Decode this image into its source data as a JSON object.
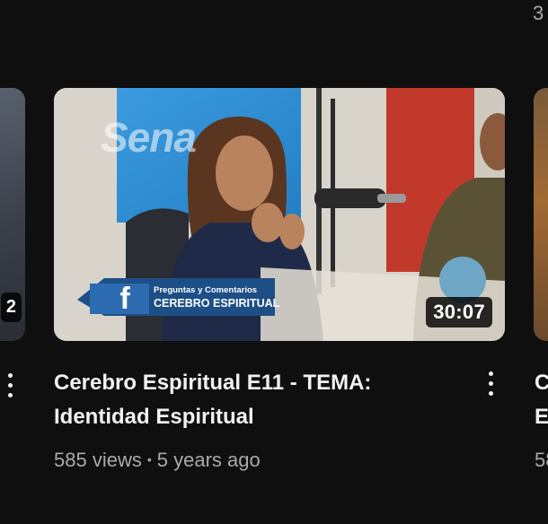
{
  "corner_count": "3",
  "left_card": {
    "duration": "2"
  },
  "main_card": {
    "duration": "30:07",
    "title": "Cerebro Espiritual E11 - TEMA: Identidad Espiritual",
    "views": "585 views",
    "separator": "•",
    "age": "5 years ago",
    "overlay": {
      "subtitle": "Preguntas y Comentarios",
      "show_name": "CEREBRO ESPIRITUAL",
      "logo": "Sena"
    }
  },
  "right_card": {
    "title_line1": "C",
    "title_line2": "E",
    "meta": "58"
  },
  "icons": {
    "menu": "more-vert-icon",
    "facebook": "facebook-icon"
  }
}
